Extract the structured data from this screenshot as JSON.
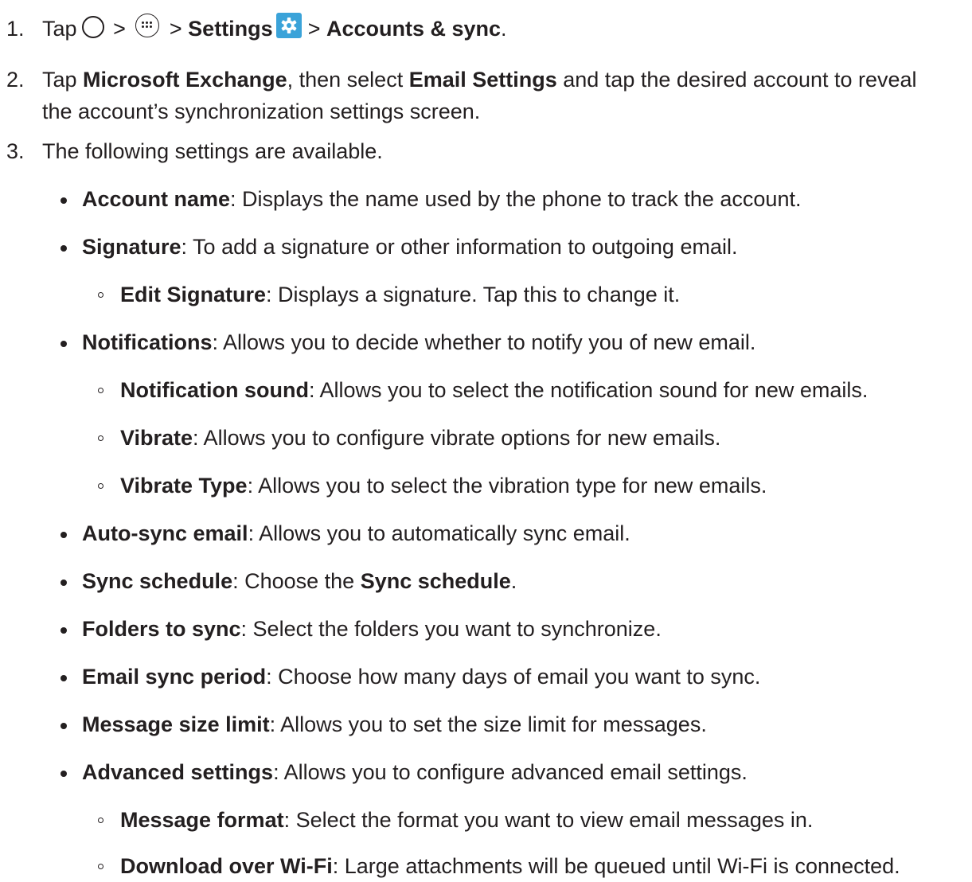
{
  "steps": [
    {
      "number": "1.",
      "text_tap": "Tap",
      "sep": ">",
      "settings": "Settings",
      "accounts_sync": "Accounts & sync",
      "end": ".",
      "icons": [
        "home-icon",
        "apps-icon",
        "settings-icon"
      ]
    },
    {
      "number": "2.",
      "pre": "Tap ",
      "microsoft_exchange": "Microsoft Exchange",
      "mid": ", then select ",
      "email_settings": "Email Settings",
      "line1_end": " and tap the desired account to reveal",
      "line2": "the account’s synchronization settings screen."
    },
    {
      "number": "3.",
      "text": "The following settings are available."
    }
  ],
  "settings_list": [
    {
      "level": 1,
      "name": "Account name",
      "desc": ": Displays the name used by the phone to track the account."
    },
    {
      "level": 1,
      "name": "Signature",
      "desc": ": To add a signature or other information to outgoing email."
    },
    {
      "level": 2,
      "name": "Edit Signature",
      "desc": ": Displays a signature. Tap this to change it."
    },
    {
      "level": 1,
      "name": "Notifications",
      "desc": ": Allows you to decide whether to notify you of new email."
    },
    {
      "level": 2,
      "name": "Notification sound",
      "desc": ": Allows you to select the notification sound for new emails."
    },
    {
      "level": 2,
      "name": "Vibrate",
      "desc": ": Allows you to configure vibrate options for new emails."
    },
    {
      "level": 2,
      "name": "Vibrate Type",
      "desc": ": Allows you to select the vibration type for new emails."
    },
    {
      "level": 1,
      "name": "Auto-sync email",
      "desc": ": Allows you to automatically sync email."
    },
    {
      "level": 1,
      "name": "Sync schedule",
      "desc": ": Choose the ",
      "name2": "Sync schedule",
      "desc2": "."
    },
    {
      "level": 1,
      "name": "Folders to sync",
      "desc": ": Select the folders you want to synchronize."
    },
    {
      "level": 1,
      "name": "Email sync period",
      "desc": ": Choose how many days of email you want to sync."
    },
    {
      "level": 1,
      "name": "Message size limit",
      "desc": ": Allows you to set the size limit for messages."
    },
    {
      "level": 1,
      "name": "Advanced settings",
      "desc": ": Allows you to configure advanced email settings."
    },
    {
      "level": 2,
      "name": "Message format",
      "desc": ": Select the format you want to view email messages in."
    },
    {
      "level": 2,
      "name": "Download over Wi-Fi",
      "desc": ": Large attachments will be queued until Wi-Fi is connected."
    }
  ]
}
